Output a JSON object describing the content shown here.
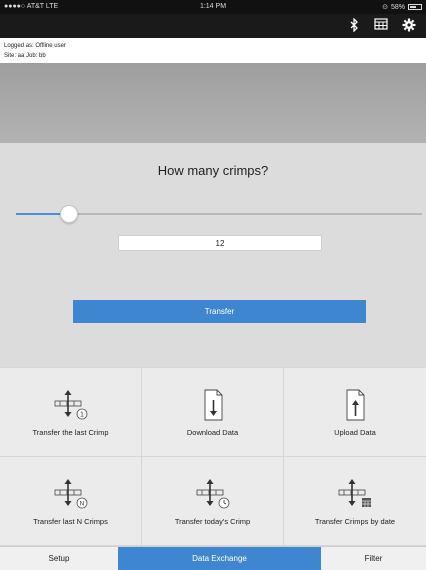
{
  "status_bar": {
    "carrier": "●●●●○ AT&T  LTE",
    "time": "1:14 PM",
    "battery": "58%"
  },
  "nav_icons": [
    "bluetooth-icon",
    "table-icon",
    "gear-icon"
  ],
  "user_info": {
    "logged_as": "Logged as: Offline user",
    "site_job": "Site: aa Job: bb"
  },
  "crimp_panel": {
    "question": "How many crimps?",
    "slider_level": 0.13,
    "count_value": "12",
    "transfer_label": "Transfer"
  },
  "actions": [
    {
      "label": "Transfer the last Crimp",
      "icon": "transfer-last-crimp-icon",
      "badge": "1"
    },
    {
      "label": "Download Data",
      "icon": "download-data-icon"
    },
    {
      "label": "Upload Data",
      "icon": "upload-data-icon"
    },
    {
      "label": "Transfer last N Crimps",
      "icon": "transfer-last-n-icon",
      "badge": "N"
    },
    {
      "label": "Transfer today's Crimp",
      "icon": "transfer-today-icon"
    },
    {
      "label": "Transfer Crimps by date",
      "icon": "transfer-by-date-icon"
    }
  ],
  "tabs": [
    {
      "label": "Setup",
      "active": false
    },
    {
      "label": "Data Exchange",
      "active": true
    },
    {
      "label": "Filter",
      "active": false
    }
  ],
  "colors": {
    "accent": "#3f86d0",
    "navbar": "#1a1a1a",
    "panel": "#dcdcdc",
    "grid": "#ebebeb"
  }
}
